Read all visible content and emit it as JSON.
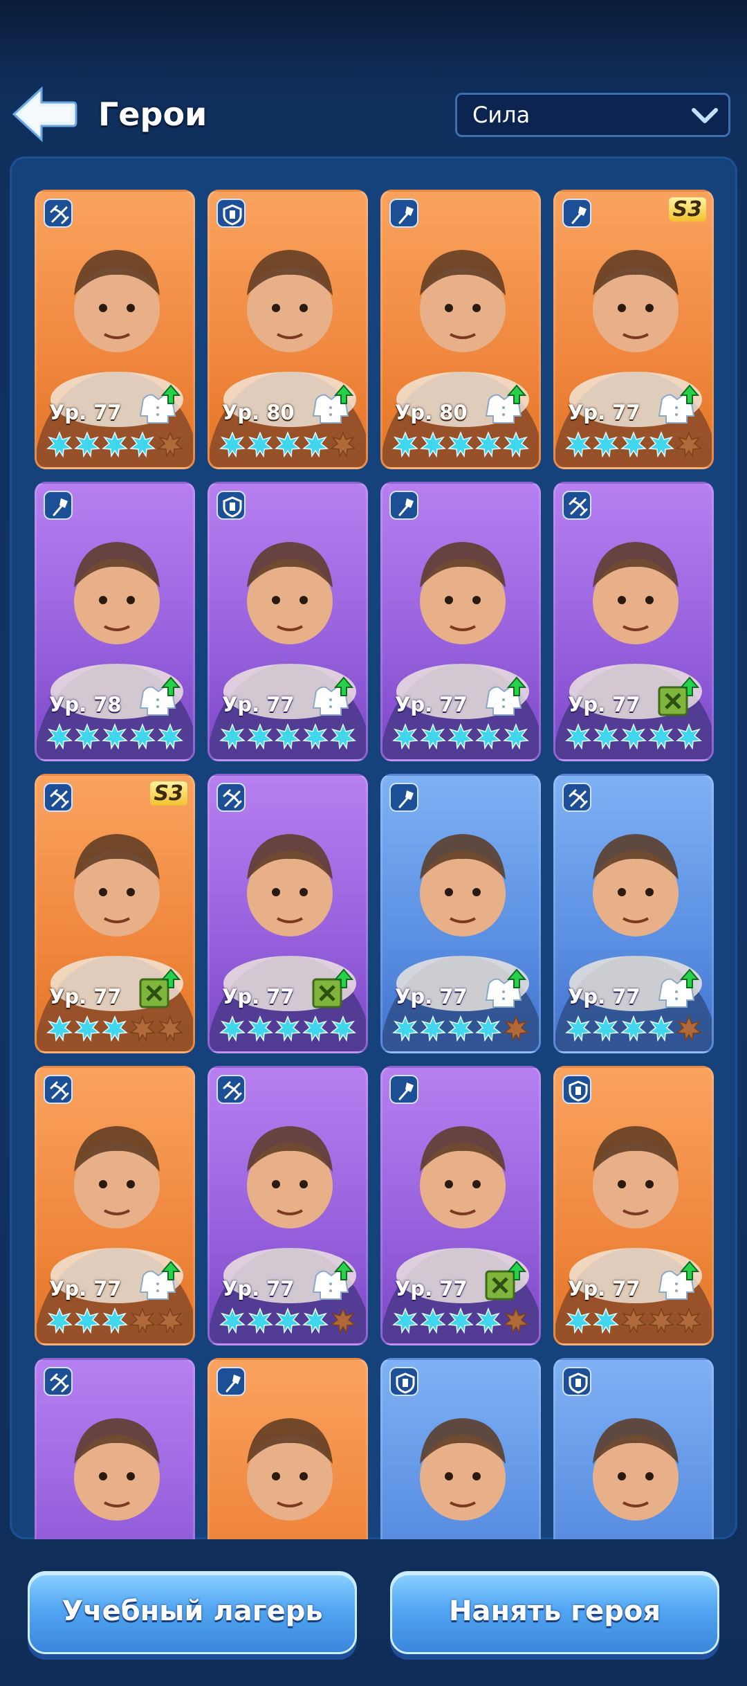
{
  "header": {
    "title": "Герои",
    "sort": {
      "selected": "Сила"
    }
  },
  "colors": {
    "orange": "#f0873e",
    "purple": "#9660dc",
    "blue": "#5a8fe2",
    "star_active": "#3fd6ee",
    "star_inactive": "#b06a3a"
  },
  "heroes": [
    {
      "role": "crossbow-icon",
      "bg": "orange",
      "level": "Ур. 77",
      "stars": 4,
      "upgrade": "jacket-upgrade-icon",
      "season": ""
    },
    {
      "role": "shield-icon",
      "bg": "orange",
      "level": "Ур. 80",
      "stars": 4,
      "upgrade": "jacket-upgrade-icon",
      "season": ""
    },
    {
      "role": "staff-icon",
      "bg": "orange",
      "level": "Ур. 80",
      "stars": 5,
      "upgrade": "jacket-upgrade-icon",
      "season": ""
    },
    {
      "role": "staff-icon",
      "bg": "orange",
      "level": "Ур. 77",
      "stars": 4,
      "upgrade": "jacket-upgrade-icon",
      "season": "S3"
    },
    {
      "role": "staff-icon",
      "bg": "purple",
      "level": "Ур. 78",
      "stars": 5,
      "upgrade": "jacket-upgrade-icon",
      "season": ""
    },
    {
      "role": "shield-icon",
      "bg": "purple",
      "level": "Ур. 77",
      "stars": 5,
      "upgrade": "jacket-upgrade-icon",
      "season": ""
    },
    {
      "role": "staff-icon",
      "bg": "purple",
      "level": "Ур. 77",
      "stars": 5,
      "upgrade": "jacket-upgrade-icon",
      "season": ""
    },
    {
      "role": "crossbow-icon",
      "bg": "purple",
      "level": "Ур. 77",
      "stars": 5,
      "upgrade": "manual-upgrade-icon",
      "season": ""
    },
    {
      "role": "crossbow-icon",
      "bg": "orange",
      "level": "Ур. 77",
      "stars": 3,
      "upgrade": "manual-upgrade-icon",
      "season": "S3"
    },
    {
      "role": "crossbow-icon",
      "bg": "purple",
      "level": "Ур. 77",
      "stars": 5,
      "upgrade": "manual-upgrade-icon",
      "season": ""
    },
    {
      "role": "staff-icon",
      "bg": "blue",
      "level": "Ур. 77",
      "stars": 4,
      "upgrade": "jacket-upgrade-icon",
      "season": ""
    },
    {
      "role": "crossbow-icon",
      "bg": "blue",
      "level": "Ур. 77",
      "stars": 4,
      "upgrade": "jacket-upgrade-icon",
      "season": ""
    },
    {
      "role": "crossbow-icon",
      "bg": "orange",
      "level": "Ур. 77",
      "stars": 3,
      "upgrade": "jacket-upgrade-icon",
      "season": ""
    },
    {
      "role": "crossbow-icon",
      "bg": "purple",
      "level": "Ур. 77",
      "stars": 4,
      "upgrade": "jacket-upgrade-icon",
      "season": ""
    },
    {
      "role": "staff-icon",
      "bg": "purple",
      "level": "Ур. 77",
      "stars": 4,
      "upgrade": "manual-upgrade-icon",
      "season": ""
    },
    {
      "role": "shield-icon",
      "bg": "orange",
      "level": "Ур. 77",
      "stars": 2,
      "upgrade": "jacket-upgrade-icon",
      "season": ""
    },
    {
      "role": "crossbow-icon",
      "bg": "purple",
      "level": "",
      "stars": 0,
      "upgrade": "",
      "season": ""
    },
    {
      "role": "staff-icon",
      "bg": "orange",
      "level": "",
      "stars": 0,
      "upgrade": "",
      "season": ""
    },
    {
      "role": "shield-icon",
      "bg": "blue",
      "level": "",
      "stars": 0,
      "upgrade": "",
      "season": ""
    },
    {
      "role": "shield-icon",
      "bg": "blue",
      "level": "",
      "stars": 0,
      "upgrade": "",
      "season": ""
    }
  ],
  "footer": {
    "training_camp": "Учебный лагерь",
    "hire_hero": "Нанять героя"
  }
}
